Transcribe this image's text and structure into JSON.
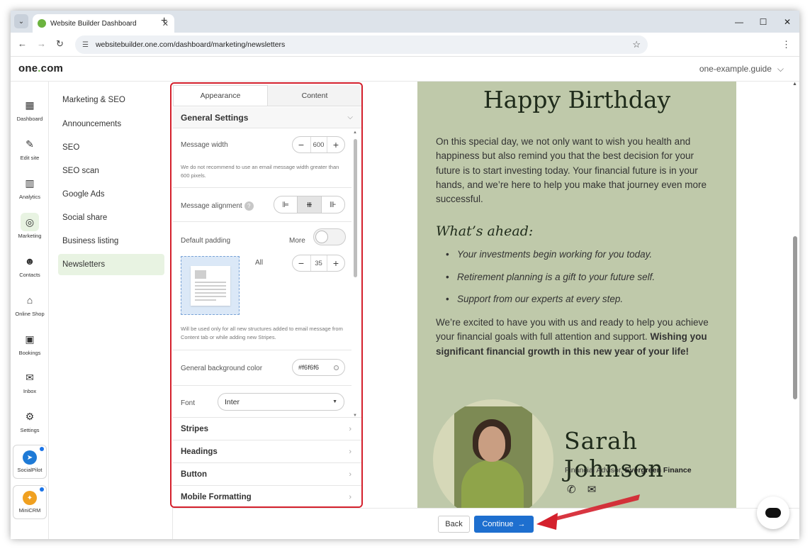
{
  "browser": {
    "tab_title": "Website Builder Dashboard",
    "url": "websitebuilder.one.com/dashboard/marketing/newsletters"
  },
  "header": {
    "logo_left": "one",
    "logo_dot": ".",
    "logo_right": "com",
    "account": "one-example.guide"
  },
  "rail": {
    "items": [
      {
        "label": "Dashboard",
        "icon": "grid-icon",
        "glyph": "▦"
      },
      {
        "label": "Edit site",
        "icon": "edit-site-icon",
        "glyph": "✎"
      },
      {
        "label": "Analytics",
        "icon": "analytics-icon",
        "glyph": "▥"
      },
      {
        "label": "Marketing",
        "icon": "target-icon",
        "glyph": "◎"
      },
      {
        "label": "Contacts",
        "icon": "contacts-icon",
        "glyph": "☻"
      },
      {
        "label": "Online Shop",
        "icon": "shop-icon",
        "glyph": "⌂"
      },
      {
        "label": "Bookings",
        "icon": "calendar-icon",
        "glyph": "▣"
      },
      {
        "label": "Inbox",
        "icon": "inbox-icon",
        "glyph": "✉"
      },
      {
        "label": "Settings",
        "icon": "gear-icon",
        "glyph": "⚙"
      }
    ],
    "apps": [
      {
        "label": "SocialPilot",
        "icon": "socialpilot-icon",
        "glyph": "➤"
      },
      {
        "label": "MiniCRM",
        "icon": "minicrm-icon",
        "glyph": "✦"
      }
    ]
  },
  "subnav": {
    "items": [
      "Marketing & SEO",
      "Announcements",
      "SEO",
      "SEO scan",
      "Google Ads",
      "Social share",
      "Business listing",
      "Newsletters"
    ]
  },
  "panel": {
    "tabs": [
      "Appearance",
      "Content"
    ],
    "general_settings": "General Settings",
    "message_width": {
      "label": "Message width",
      "value": "600",
      "help": "We do not recommend to use an email message width greater than 600 pixels."
    },
    "message_alignment": {
      "label": "Message alignment",
      "help_icon": "?"
    },
    "default_padding": {
      "label": "Default padding",
      "more": "More",
      "all": "All",
      "value": "35",
      "help": "Will be used only for all new structures added to email message from Content tab or while adding new Stripes."
    },
    "background": {
      "label": "General background color",
      "value": "#f6f6f6"
    },
    "font": {
      "label": "Font",
      "value": "Inter"
    },
    "sections": [
      "Stripes",
      "Headings",
      "Button",
      "Mobile Formatting"
    ]
  },
  "email": {
    "title": "Happy Birthday",
    "intro": "On this special day, we not only want to wish you health and happiness but also remind you that the best decision for your future is to start investing today. Your financial future is in your hands, and we’re here to help you make that journey even more successful.",
    "subheading": "What’s ahead:",
    "bullets": [
      "Your investments begin working for you today.",
      "Retirement planning is a gift to your future self.",
      "Support from our experts at every step."
    ],
    "closing": "We’re excited to have you with us and ready to help you achieve your financial goals with full attention and support.",
    "closing_bold": "Wishing you significant financial growth in this new year of your life!",
    "signature_name": "Sarah Johnson",
    "signature_role": "Financial Advisor, ",
    "signature_company": "Evergreen Finance"
  },
  "footer": {
    "back": "Back",
    "continue": "Continue"
  },
  "colors": {
    "accent": "#6cb33f",
    "primary_button": "#1e6fcf",
    "highlight_border": "#d4202c",
    "email_bg": "#bfc9aa"
  }
}
